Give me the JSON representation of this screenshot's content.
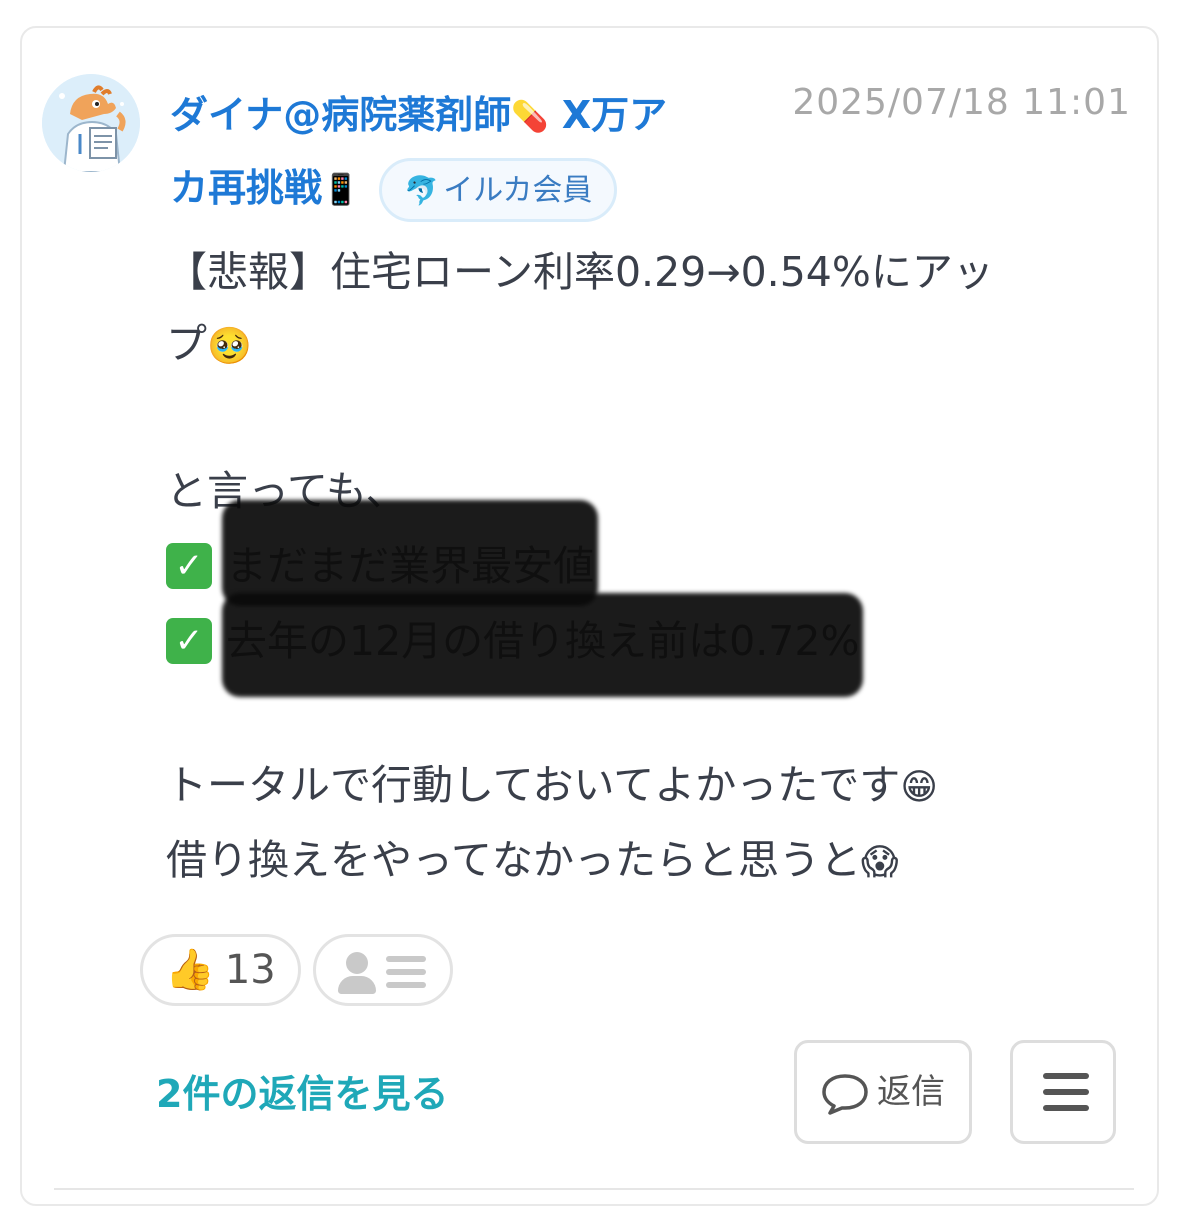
{
  "post": {
    "author": {
      "name": "ダイナ@病院薬剤師💊 X万アカ再挑戦📱",
      "name_line1": "ダイナ@病院薬剤師",
      "name_line1_icon": "💊",
      "name_line1_suffix": " X万ア",
      "name_line2": "カ再挑戦",
      "name_line2_icon": "📱",
      "badge_icon": "🐬",
      "badge_label": "イルカ会員"
    },
    "timestamp": "2025/07/18 11:01",
    "body": {
      "line1": "【悲報】住宅ローン利率0.29→0.54%にアッ",
      "line2": "プ",
      "line2_emoji": "🥹",
      "line3": "と言っても、",
      "check1_text": "まだまだ業界最安値",
      "check2_text": "去年の12月の借り換え前は0.72%",
      "line4": "トータルで行動しておいてよかったです",
      "line4_emoji": "😁",
      "line5": "借り換えをやってなかったらと思うと",
      "line5_emoji": "😱"
    },
    "reactions": {
      "like_icon": "👍",
      "like_count": "13",
      "viewers_icon": "viewer-list-icon"
    },
    "footer": {
      "view_replies_label": "2件の返信を見る",
      "reply_label": "返信",
      "reply_icon": "speech-bubble-icon",
      "menu_icon": "hamburger-menu-icon"
    },
    "colors": {
      "author_name": "#1e79d6",
      "replies_link": "#1fa8b8",
      "timestamp": "#a8a8a8",
      "body_text": "#3a3f4a",
      "check": "#3fb24a"
    }
  }
}
